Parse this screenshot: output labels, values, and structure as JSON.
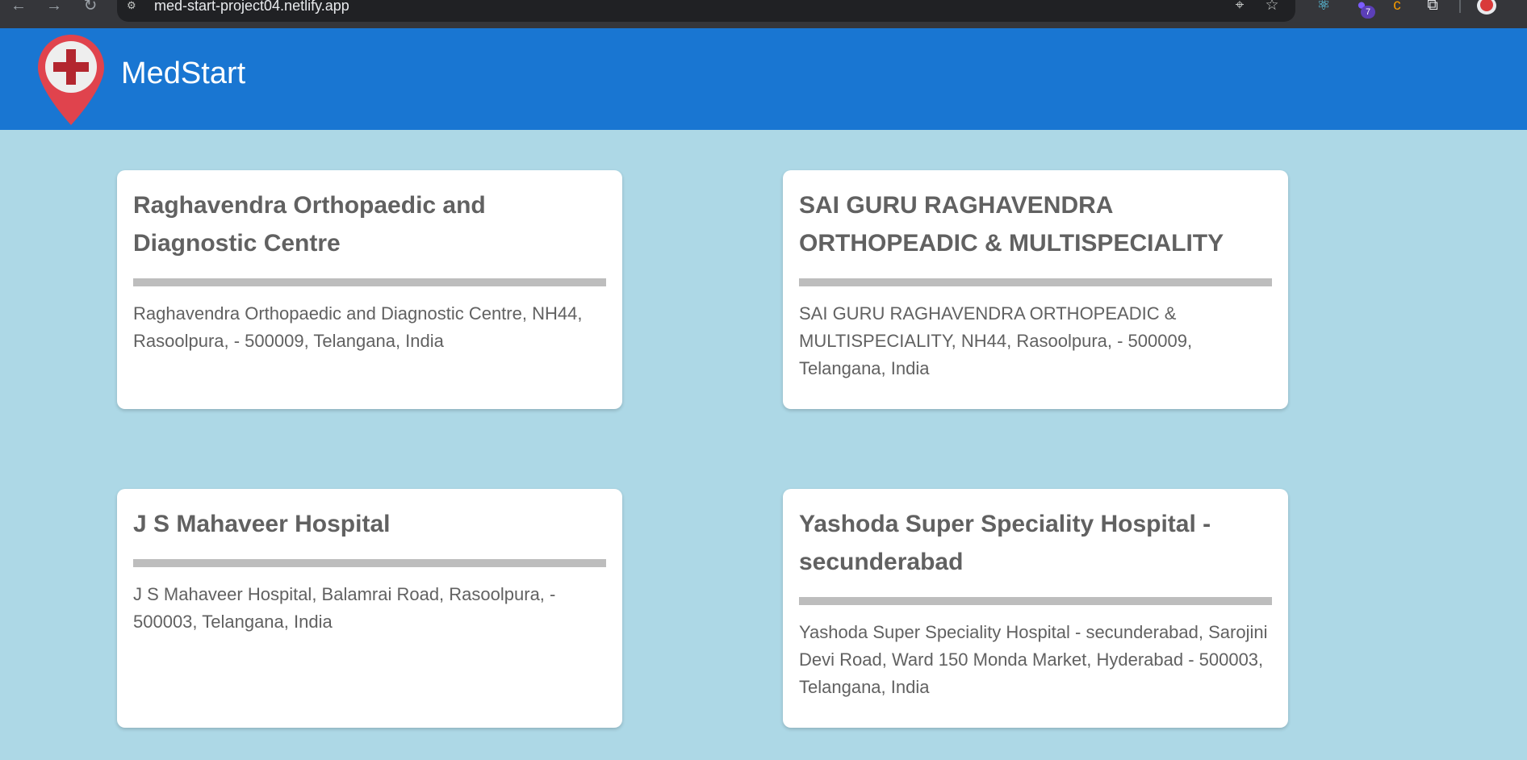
{
  "browser": {
    "back_icon": "arrow-left",
    "forward_icon": "arrow-right",
    "reload_icon": "reload",
    "site_settings_icon": "tune",
    "url": "med-start-project04.netlify.app",
    "location_icon": "location-pin",
    "bookmark_icon": "star-outline",
    "extensions": [
      {
        "name": "react-devtools-icon",
        "glyph": "⚛",
        "color": "#61dafb"
      },
      {
        "name": "extension-purple-icon",
        "glyph": "●",
        "color": "#7c5cff",
        "badge": "7"
      },
      {
        "name": "extension-c-icon",
        "glyph": "c",
        "color": "#f29900"
      },
      {
        "name": "extensions-puzzle-icon",
        "glyph": "⧉",
        "color": "#e8eaed"
      }
    ]
  },
  "app": {
    "brand": "MedStart",
    "logo_icon": "map-pin-medical-cross",
    "colors": {
      "header": "#1976d2",
      "background": "#add8e6",
      "pin": "#e0434d",
      "cross": "#b3262f"
    }
  },
  "hospitals": [
    {
      "name": "Raghavendra Orthopaedic and Diagnostic Centre",
      "address": "Raghavendra Orthopaedic and Diagnostic Centre, NH44, Rasoolpura, - 500009, Telangana, India"
    },
    {
      "name": "SAI GURU RAGHAVENDRA ORTHOPEADIC & MULTISPECIALITY",
      "address": "SAI GURU RAGHAVENDRA ORTHOPEADIC & MULTISPECIALITY, NH44, Rasoolpura, - 500009, Telangana, India"
    },
    {
      "name": "J S Mahaveer Hospital",
      "address": "J S Mahaveer Hospital, Balamrai Road, Rasoolpura, - 500003, Telangana, India"
    },
    {
      "name": "Yashoda Super Speciality Hospital - secunderabad",
      "address": "Yashoda Super Speciality Hospital - secunderabad, Sarojini Devi Road, Ward 150 Monda Market, Hyderabad - 500003, Telangana, India"
    }
  ]
}
